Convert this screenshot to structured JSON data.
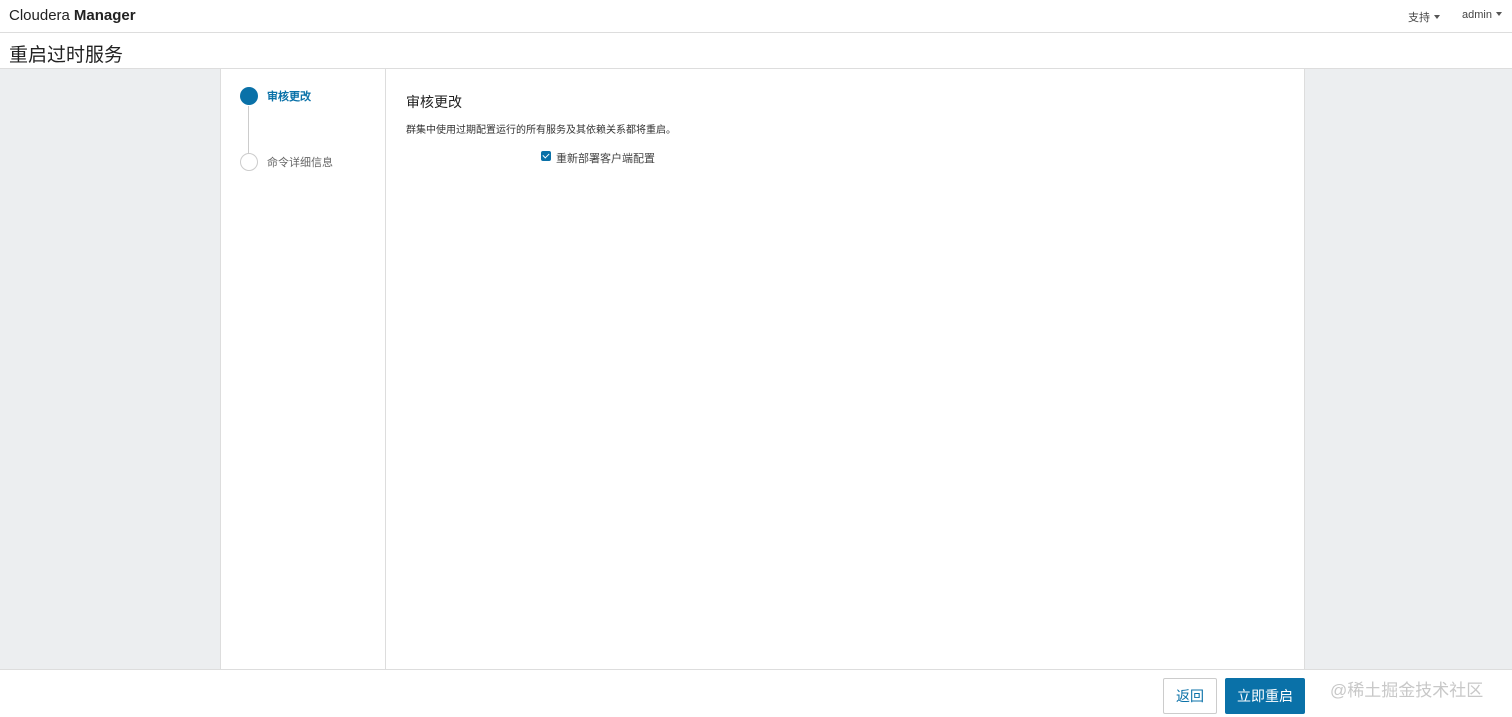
{
  "header": {
    "brand_light": "Cloudera",
    "brand_bold": "Manager",
    "support_label": "支持",
    "admin_label": "admin"
  },
  "page": {
    "title": "重启过时服务"
  },
  "steps": [
    {
      "label": "审核更改",
      "state": "active"
    },
    {
      "label": "命令详细信息",
      "state": "inactive"
    }
  ],
  "content": {
    "section_title": "审核更改",
    "description": "群集中使用过期配置运行的所有服务及其依赖关系都将重启。",
    "redeploy_option": {
      "label": "重新部署客户端配置",
      "checked": true
    }
  },
  "footer": {
    "back_label": "返回",
    "restart_label": "立即重启",
    "watermark": "@稀土掘金技术社区"
  },
  "colors": {
    "accent": "#0a71a8",
    "background": "#eceef0"
  }
}
